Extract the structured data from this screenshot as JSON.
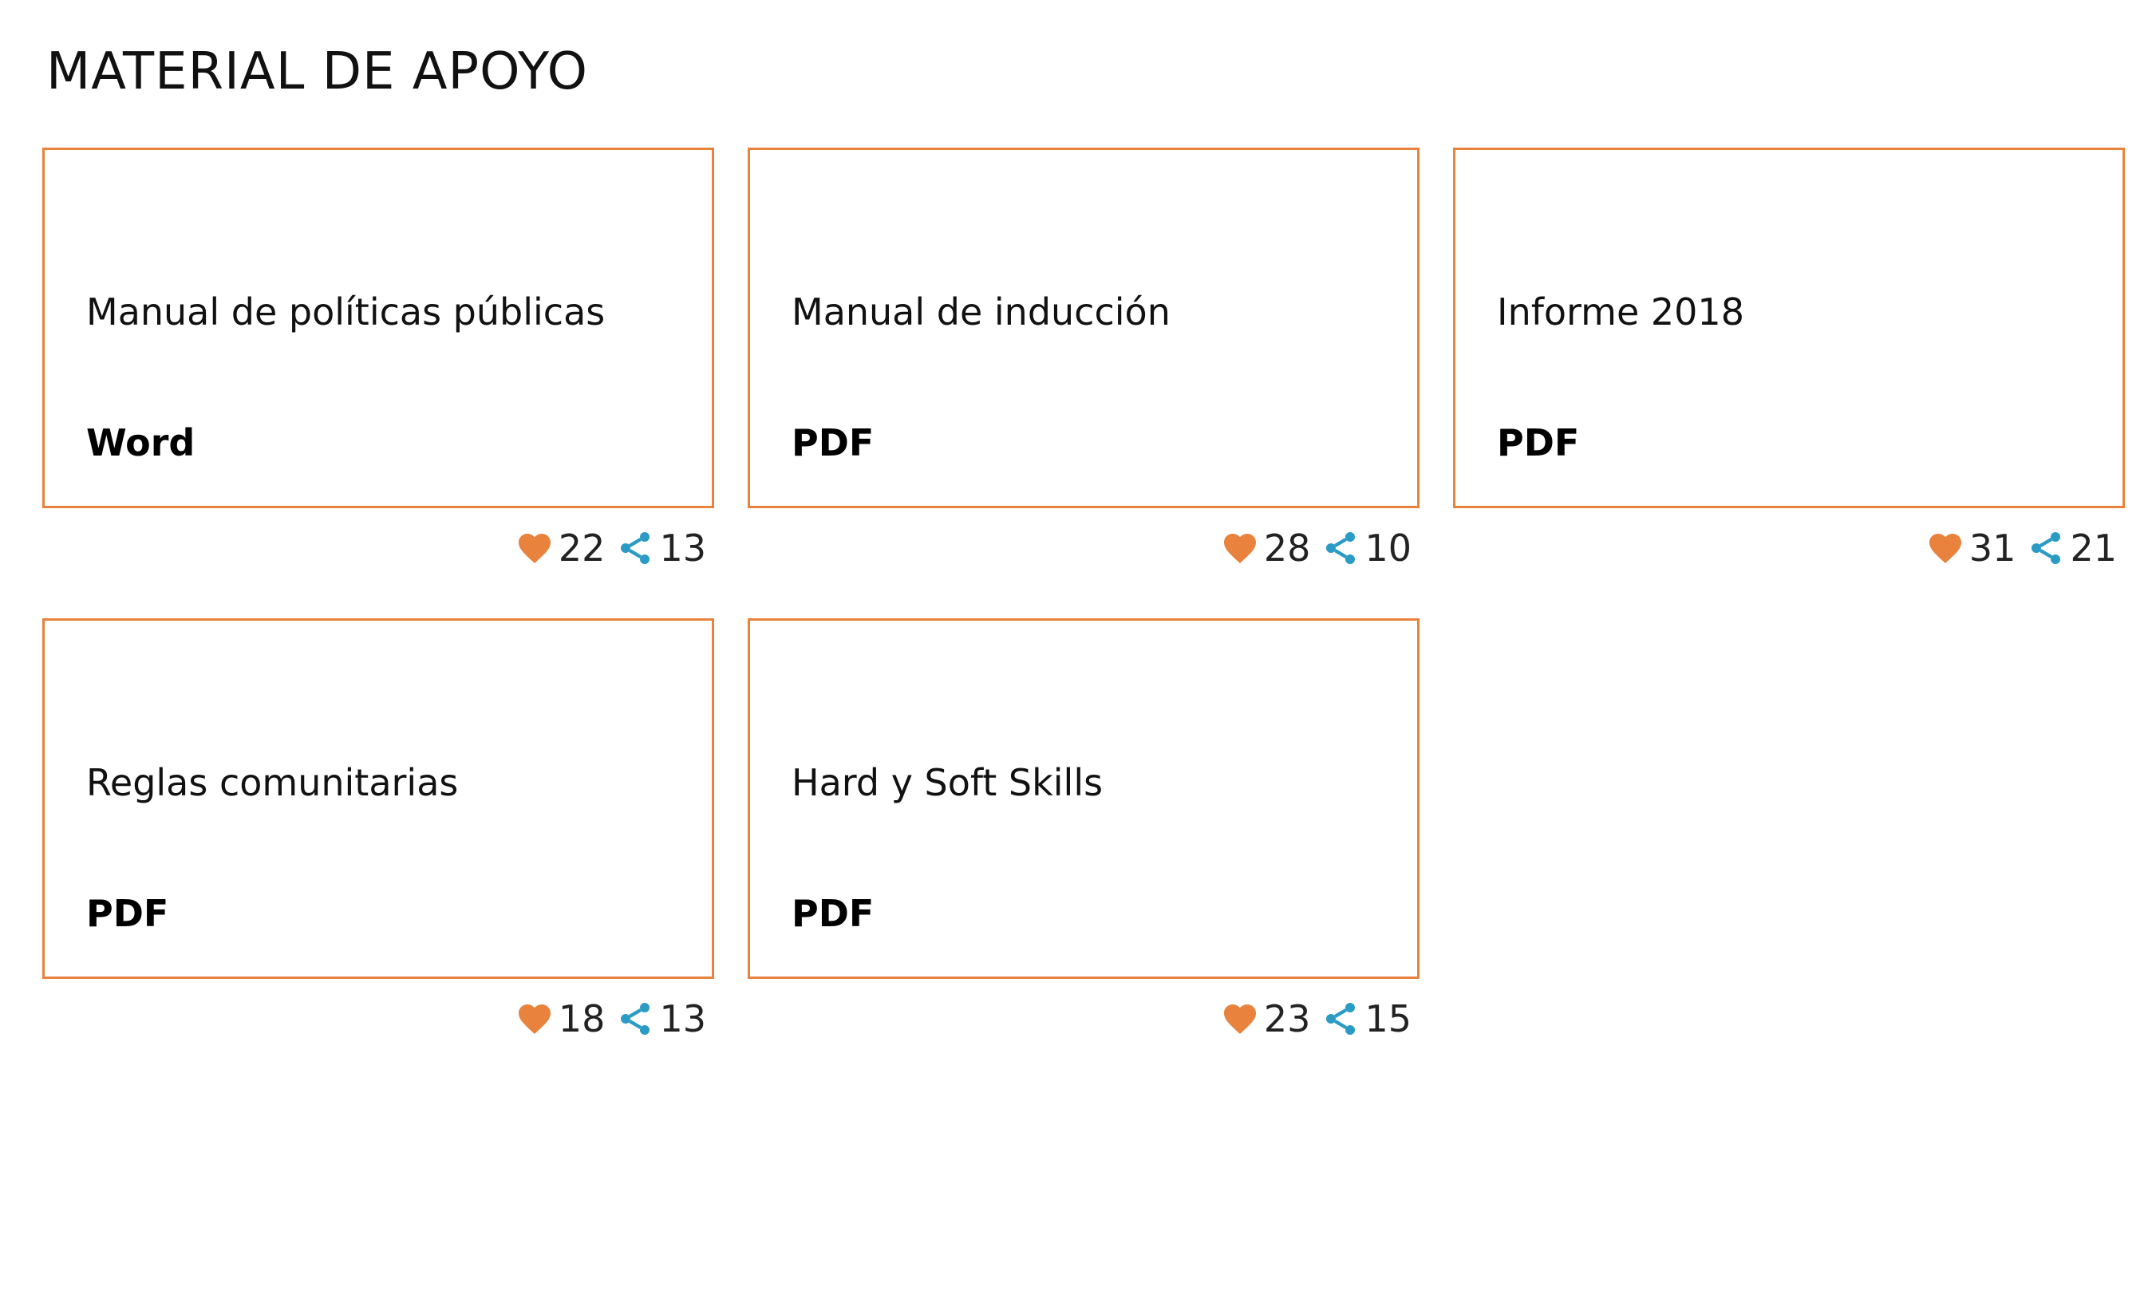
{
  "page": {
    "title": "MATERIAL DE APOYO"
  },
  "colors": {
    "accent": "#e8823c",
    "share": "#2a9bc4",
    "text": "#111111"
  },
  "icons": {
    "like": "heart-icon",
    "share": "share-icon"
  },
  "materials": [
    {
      "title": "Manual de políticas públicas",
      "type": "Word",
      "likes": "22",
      "shares": "13"
    },
    {
      "title": "Manual de inducción",
      "type": "PDF",
      "likes": "28",
      "shares": "10"
    },
    {
      "title": "Informe 2018",
      "type": "PDF",
      "likes": "31",
      "shares": "21"
    },
    {
      "title": "Reglas comunitarias",
      "type": "PDF",
      "likes": "18",
      "shares": "13"
    },
    {
      "title": "Hard y Soft Skills",
      "type": "PDF",
      "likes": "23",
      "shares": "15"
    }
  ]
}
